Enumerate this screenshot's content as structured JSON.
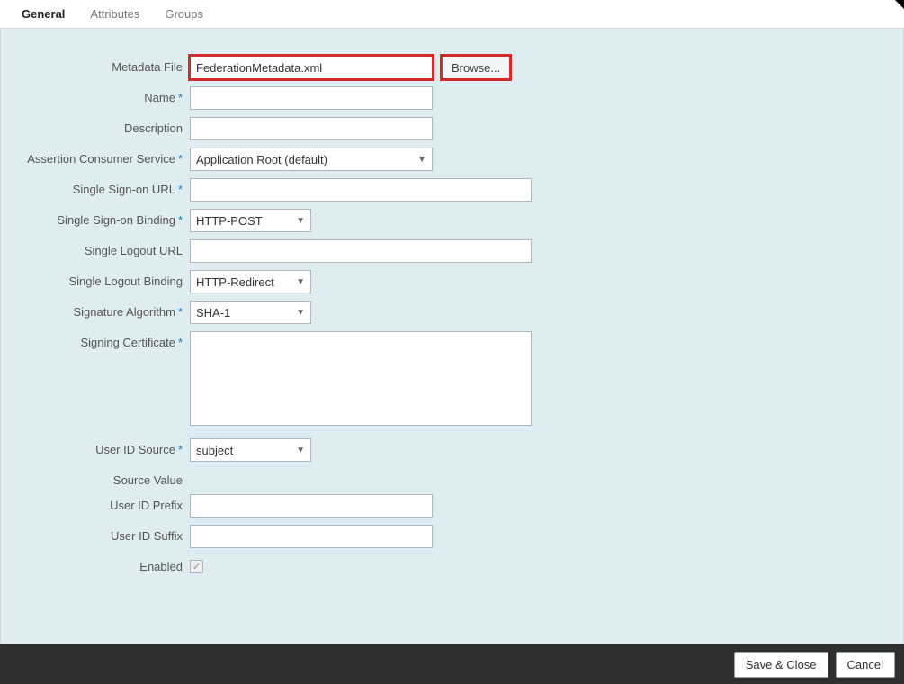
{
  "tabs": {
    "general": "General",
    "attributes": "Attributes",
    "groups": "Groups"
  },
  "form": {
    "metadataFile": {
      "label": "Metadata File",
      "value": "FederationMetadata.xml"
    },
    "browseLabel": "Browse...",
    "name": {
      "label": "Name",
      "value": ""
    },
    "description": {
      "label": "Description",
      "value": ""
    },
    "acs": {
      "label": "Assertion Consumer Service",
      "value": "Application Root (default)"
    },
    "ssoUrl": {
      "label": "Single Sign-on URL",
      "value": ""
    },
    "ssoBinding": {
      "label": "Single Sign-on Binding",
      "value": "HTTP-POST"
    },
    "sloUrl": {
      "label": "Single Logout URL",
      "value": ""
    },
    "sloBinding": {
      "label": "Single Logout Binding",
      "value": "HTTP-Redirect"
    },
    "sigAlg": {
      "label": "Signature Algorithm",
      "value": "SHA-1"
    },
    "signingCert": {
      "label": "Signing Certificate",
      "value": ""
    },
    "userIdSource": {
      "label": "User ID Source",
      "value": "subject"
    },
    "sourceValue": {
      "label": "Source Value"
    },
    "userIdPrefix": {
      "label": "User ID Prefix",
      "value": ""
    },
    "userIdSuffix": {
      "label": "User ID Suffix",
      "value": ""
    },
    "enabled": {
      "label": "Enabled",
      "checked": true
    }
  },
  "footer": {
    "saveClose": "Save & Close",
    "cancel": "Cancel"
  }
}
